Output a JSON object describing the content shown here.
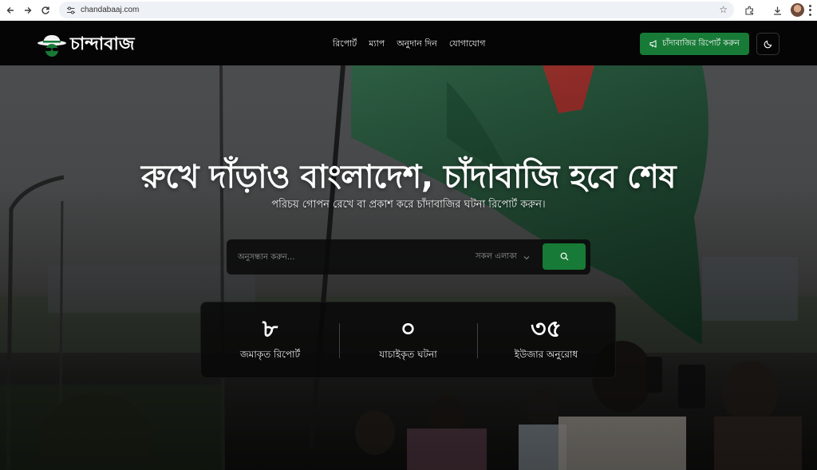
{
  "browser": {
    "url": "chandabaaj.com"
  },
  "header": {
    "logo_text": "চান্দাবাজ",
    "nav": [
      "রিপোর্ট",
      "ম্যাপ",
      "অনুদান দিন",
      "যোগাযোগ"
    ],
    "report_button": "চাঁদাবাজির রিপোর্ট করুন"
  },
  "hero": {
    "title": "রুখে দাঁড়াও বাংলাদেশ, চাঁদাবাজি হবে শেষ",
    "subtitle": "পরিচয় গোপন রেখে বা প্রকাশ করে চাঁদাবাজির ঘটনা রিপোর্ট করুন।",
    "search": {
      "placeholder": "অনুসন্ধান করুন...",
      "area_select": "সকল এলাকা"
    },
    "stats": [
      {
        "value": "৮",
        "label": "জমাকৃত রিপোর্ট"
      },
      {
        "value": "০",
        "label": "যাচাইকৃত ঘটনা"
      },
      {
        "value": "৩৫",
        "label": "ইউজার অনুরোধ"
      }
    ]
  },
  "colors": {
    "brand_green": "#177a36",
    "header_bg": "#050505",
    "flag_green": "#1f5a3a",
    "flag_red": "#b52a2a"
  },
  "icons": {
    "back": "arrow-left-icon",
    "forward": "arrow-right-icon",
    "reload": "reload-icon",
    "site_info": "tune-icon",
    "bookmark": "star-icon",
    "extensions": "puzzle-icon",
    "download": "download-icon",
    "logo": "spy-hat-icon",
    "report": "megaphone-icon",
    "theme": "moon-icon",
    "search": "search-icon",
    "area_select": "chevron-down-icon"
  }
}
